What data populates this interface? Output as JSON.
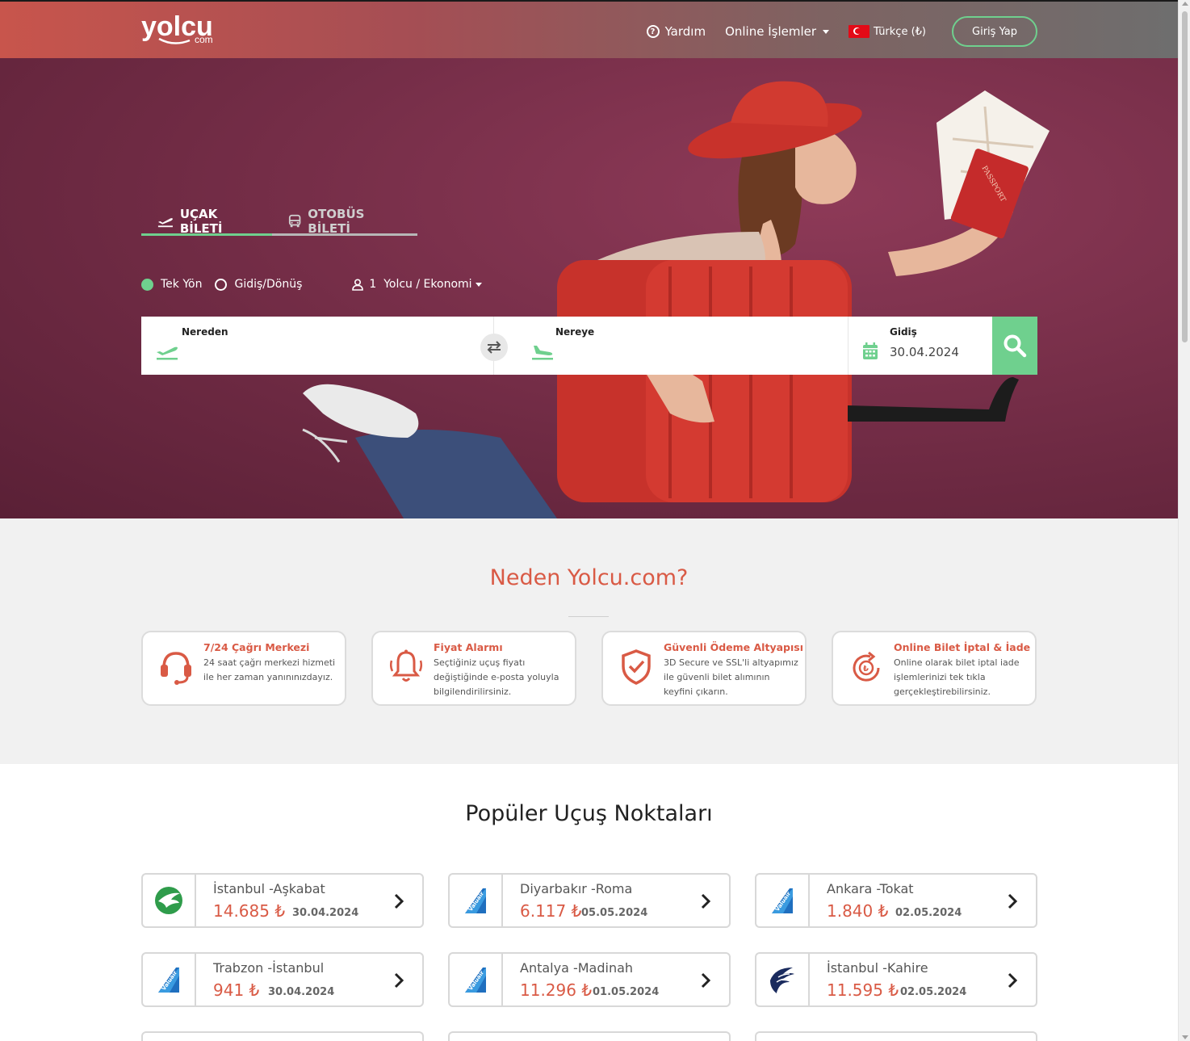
{
  "header": {
    "logo_main": "yolcu",
    "logo_sub": "com",
    "help_label": "Yardım",
    "online_label": "Online İşlemler",
    "language_label": "Türkçe (₺)",
    "login_label": "Giriş Yap"
  },
  "tabs": {
    "flight_label": "UÇAK BİLETİ",
    "bus_label": "OTOBÜS BİLETİ"
  },
  "trip_options": {
    "one_way_label": "Tek Yön",
    "round_trip_label": "Gidiş/Dönüş",
    "passenger_label": "1  Yolcu / Ekonomi",
    "selected": "one_way"
  },
  "search": {
    "from_label": "Nereden",
    "from_value": "",
    "to_label": "Nereye",
    "to_value": "",
    "date_label": "Gidiş",
    "date_value": "30.04.2024"
  },
  "illustration": {
    "passport_text": "PASSPORT"
  },
  "why": {
    "title": "Neden Yolcu.com?",
    "cards": [
      {
        "icon": "headset-icon",
        "title": "7/24 Çağrı Merkezi",
        "desc": "24 saat çağrı merkezi hizmeti ile her zaman yanınınızdayız."
      },
      {
        "icon": "bell-icon",
        "title": "Fiyat Alarmı",
        "desc": "Seçtiğiniz uçuş fiyatı değiştiğinde e-posta yoluyla bilgilendirilirsiniz."
      },
      {
        "icon": "shield-check-icon",
        "title": "Güvenli Ödeme Altyapısı",
        "desc": "3D Secure ve SSL'li altyapımız ile güvenli bilet alımının keyfini çıkarın."
      },
      {
        "icon": "refund-icon",
        "title": "Online Bilet İptal & İade",
        "desc": "Online olarak bilet iptal iade işlemlerinizi tek tıkla gerçekleştirebilirsiniz."
      }
    ]
  },
  "popular": {
    "title": "Popüler Uçuş Noktaları",
    "routes": [
      {
        "airline": "turkmenistan",
        "route": "İstanbul -Aşkabat",
        "price": "14.685 ₺",
        "date": "30.04.2024"
      },
      {
        "airline": "valuair",
        "route": "Diyarbakır -Roma",
        "price": "6.117 ₺",
        "date": "05.05.2024"
      },
      {
        "airline": "valuair",
        "route": "Ankara -Tokat",
        "price": "1.840 ₺",
        "date": "02.05.2024"
      },
      {
        "airline": "valuair",
        "route": "Trabzon -İstanbul",
        "price": "941 ₺",
        "date": "30.04.2024"
      },
      {
        "airline": "valuair",
        "route": "Antalya -Madinah",
        "price": "11.296 ₺",
        "date": "01.05.2024"
      },
      {
        "airline": "egyptair",
        "route": "İstanbul -Kahire",
        "price": "11.595 ₺",
        "date": "02.05.2024"
      }
    ]
  },
  "colors": {
    "accent_green": "#6fd08e",
    "accent_red": "#d95a45",
    "hero_bg": "#7a2f48"
  }
}
